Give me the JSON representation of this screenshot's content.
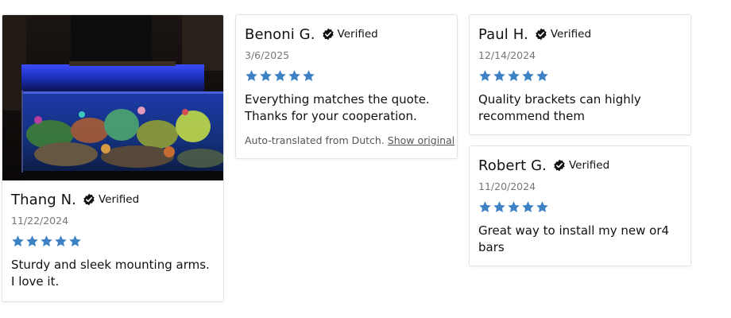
{
  "colors": {
    "star": "#3e82c5",
    "verified": "#111111",
    "date": "#767676",
    "border": "#e3e3e3"
  },
  "reviews": [
    {
      "reviewer": "Thang N.",
      "verified_label": "Verified",
      "date": "11/22/2024",
      "rating": 5,
      "text": "Sturdy and sleek mounting arms. I love it.",
      "has_photo": true,
      "photo_icon": "aquarium-photo"
    },
    {
      "reviewer": "Benoni G.",
      "verified_label": "Verified",
      "date": "3/6/2025",
      "rating": 5,
      "text": "Everything matches the quote. Thanks for your cooperation.",
      "translation_note": "Auto-translated from Dutch.",
      "translation_link": "Show original"
    },
    {
      "reviewer": "Paul H.",
      "verified_label": "Verified",
      "date": "12/14/2024",
      "rating": 5,
      "text": "Quality brackets can highly recommend them"
    },
    {
      "reviewer": "Robert G.",
      "verified_label": "Verified",
      "date": "11/20/2024",
      "rating": 5,
      "text": "Great way to install my new or4 bars"
    }
  ]
}
